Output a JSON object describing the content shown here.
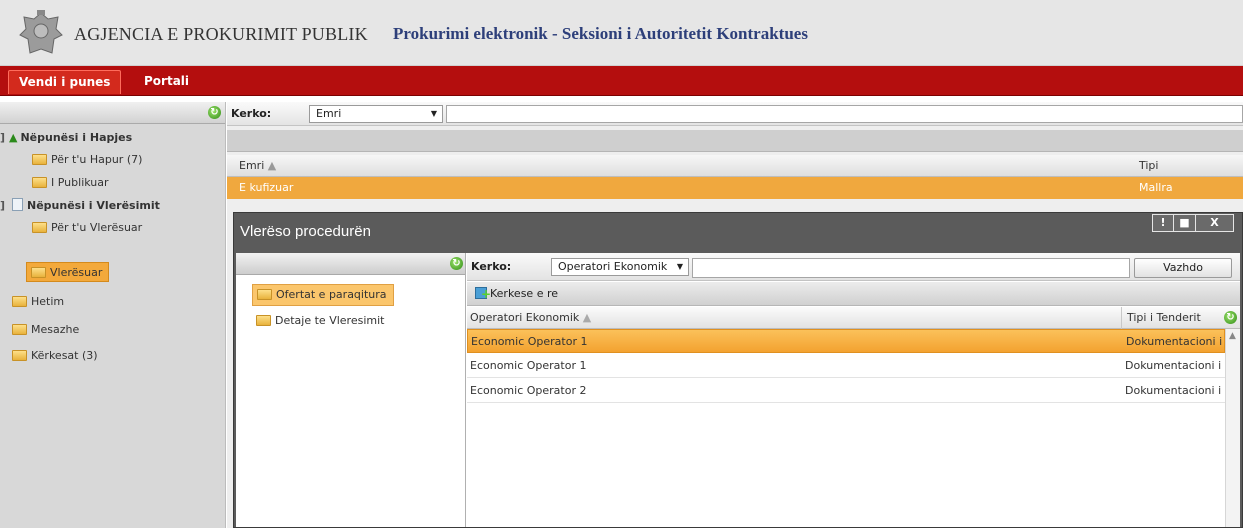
{
  "header": {
    "agency": "AGJENCIA E PROKURIMIT PUBLIK",
    "subsystem": "Prokurimi elektronik - Seksioni i Autoritetit Kontraktues"
  },
  "nav": {
    "tabs": [
      {
        "label": "Vendi i punes",
        "active": true
      },
      {
        "label": "Portali",
        "active": false
      }
    ]
  },
  "sidebar": {
    "items": [
      {
        "label": "Nëpunësi i Hapjes",
        "type": "root"
      },
      {
        "label": "Për t'u Hapur (7)",
        "type": "folder"
      },
      {
        "label": "I Publikuar",
        "type": "folder"
      },
      {
        "label": "Nëpunësi i Vlerësimit",
        "type": "root"
      },
      {
        "label": "Për t'u Vlerësuar",
        "type": "folder"
      },
      {
        "label": "Vlerësuar",
        "type": "folder",
        "selected": true
      },
      {
        "label": "Hetim",
        "type": "folder"
      },
      {
        "label": "Mesazhe",
        "type": "folder"
      },
      {
        "label": "Kërkesat (3)",
        "type": "folder"
      }
    ]
  },
  "main": {
    "search_label": "Kerko:",
    "search_field": "Emri",
    "columns": [
      "Emri",
      "Tipi"
    ],
    "selected_row": {
      "name": "E kufizuar",
      "type": "Mallra"
    }
  },
  "modal": {
    "title": "Vlerëso procedurën",
    "window_buttons": [
      "!",
      "■",
      "X"
    ],
    "left_items": [
      {
        "label": "Ofertat e paraqitura",
        "selected": true
      },
      {
        "label": "Detaje te Vleresimit",
        "selected": false
      }
    ],
    "search_label": "Kerko:",
    "search_field": "Operatori Ekonomik",
    "search_value": "",
    "continue_button": "Vazhdo",
    "new_request": "Kerkese e re",
    "columns": [
      "Operatori Ekonomik",
      "Tipi i Tenderit"
    ],
    "rows": [
      {
        "operator": "Economic Operator 1",
        "type": "Dokumentacioni i",
        "selected": true
      },
      {
        "operator": "Economic Operator 1",
        "type": "Dokumentacioni i",
        "selected": false
      },
      {
        "operator": "Economic Operator 2",
        "type": "Dokumentacioni i",
        "selected": false
      }
    ]
  },
  "colors": {
    "navbar": "#b40e0e",
    "selection": "#f3a230",
    "modal_chrome": "#5b5b5b",
    "subsystem_text": "#2d3f7a"
  },
  "icons": [
    "coat-of-arms-logo",
    "refresh-icon",
    "up-arrow-icon",
    "document-icon",
    "folder-icon",
    "new-request-icon",
    "sort-arrow-icon"
  ]
}
